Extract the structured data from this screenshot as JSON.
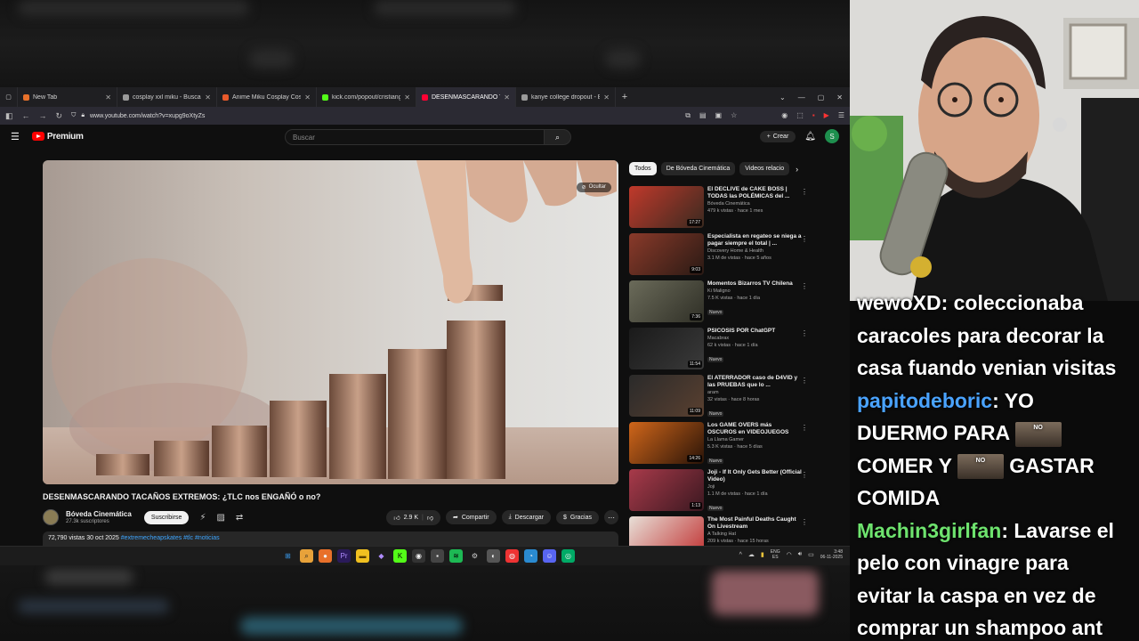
{
  "browser": {
    "tabs": [
      {
        "label": "New Tab",
        "favicon_color": "#e8712b",
        "active": false
      },
      {
        "label": "cosplay xxl miku - Buscar con G",
        "favicon_color": "#9a9a9a",
        "active": false
      },
      {
        "label": "Anime Miku Cosplay Costume |",
        "favicon_color": "#e85a2b",
        "active": false
      },
      {
        "label": "kick.com/popout/cristianghost",
        "favicon_color": "#53fc18",
        "active": false
      },
      {
        "label": "DESENMASCARANDO TACAÑ",
        "favicon_color": "#ff0033",
        "active": true
      },
      {
        "label": "kanye college dropout - Buscar",
        "favicon_color": "#9a9a9a",
        "active": false
      }
    ],
    "url": "www.youtube.com/watch?v=xupg9oXtyZs"
  },
  "youtube": {
    "logo_text": "Premium",
    "search_placeholder": "Buscar",
    "create_label": "Crear",
    "user_initial": "S",
    "hide_label": "Ocultar",
    "video_title": "DESENMASCARANDO TACAÑOS EXTREMOS: ¿TLC nos ENGAÑÓ o no?",
    "channel_name": "Bóveda Cinemática",
    "subscribers": "27.3k suscriptores",
    "subscribe_label": "Suscribirse",
    "likes": "2.9 K",
    "share_label": "Compartir",
    "download_label": "Descargar",
    "thanks_label": "Gracias",
    "views_date": "72,790 vistas  30 oct 2025",
    "tags": "#extremecheapskates #tlc #noticias",
    "chips": [
      "Todos",
      "De Bóveda Cinemática",
      "Videos relacio"
    ],
    "recommendations": [
      {
        "title": "El DECLIVE de CAKE BOSS | TODAS las POLÉMICAS del ...",
        "channel": "Bóveda Cinemática",
        "meta": "479 k vistas · hace 1 mes",
        "duration": "17:27",
        "badge": "",
        "thumb": [
          "#c0392b",
          "#3a2a20"
        ]
      },
      {
        "title": "Especialista en regateo se niega a pagar siempre el total | ...",
        "channel": "Discovery Home & Health",
        "meta": "3.1 M de vistas · hace 5 años",
        "duration": "9:03",
        "badge": "",
        "thumb": [
          "#8a3a2a",
          "#2a1a14"
        ]
      },
      {
        "title": "Momentos Bizarros TV Chilena",
        "channel": "Ki Maligno",
        "meta": "7.5 K vistas · hace 1 día",
        "duration": "7:36",
        "badge": "Nuevo",
        "thumb": [
          "#6b6b5a",
          "#2f2f26"
        ]
      },
      {
        "title": "PSICOSIS POR ChatGPT",
        "channel": "Macabrax",
        "meta": "62 k vistas · hace 1 día",
        "duration": "11:54",
        "badge": "Nuevo",
        "thumb": [
          "#1a1a1a",
          "#3a3a3a"
        ]
      },
      {
        "title": "El ATERRADOR caso de D4VID y las PRUEBAS que lo ...",
        "channel": "aram",
        "meta": "32 vistas · hace 8 horas",
        "duration": "11:09",
        "badge": "Nuevo",
        "thumb": [
          "#2a2a2a",
          "#5a4030"
        ]
      },
      {
        "title": "Los GAME OVERS más OSCUROS en VIDEOJUEGOS",
        "channel": "La Llama Gamer",
        "meta": "5.3 K vistas · hace 5 días",
        "duration": "14:26",
        "badge": "Nuevo",
        "thumb": [
          "#d0661a",
          "#2a1408"
        ]
      },
      {
        "title": "Joji - If It Only Gets Better (Official Video)",
        "channel": "Joji",
        "meta": "1.1 M de vistas · hace 1 día",
        "duration": "1:13",
        "badge": "Nuevo",
        "thumb": [
          "#a83a4a",
          "#3a1820"
        ]
      },
      {
        "title": "The Most Painful Deaths Caught On Livestream",
        "channel": "A Talking Hat",
        "meta": "209 k vistas · hace 15 horas",
        "duration": "",
        "badge": "",
        "thumb": [
          "#e8e0d8",
          "#c03030"
        ]
      }
    ]
  },
  "taskbar": {
    "lang": "ENG\nES",
    "time": "3:48\n06-11-2025"
  },
  "chat": [
    {
      "user": "wewoXD",
      "color": "#ffffff",
      "parts": [
        {
          "text": "coleccionaba"
        }
      ]
    },
    {
      "user": "",
      "color": "",
      "parts": [
        {
          "text": "caracoles para decorar la"
        }
      ]
    },
    {
      "user": "",
      "color": "",
      "parts": [
        {
          "text": "casa fuando venian visitas"
        }
      ]
    },
    {
      "user": "papitodeboric",
      "color": "#4aa3ff",
      "parts": [
        {
          "text": "YO"
        }
      ]
    },
    {
      "user": "",
      "color": "",
      "parts": [
        {
          "text": "DUERMO PARA "
        },
        {
          "emote": "NO"
        }
      ]
    },
    {
      "user": "",
      "color": "",
      "parts": [
        {
          "text": "COMER Y "
        },
        {
          "emote": "NO"
        },
        {
          "text": " GASTAR"
        }
      ]
    },
    {
      "user": "",
      "color": "",
      "parts": [
        {
          "text": "COMIDA"
        }
      ]
    },
    {
      "user": "Machin3girlfan",
      "color": "#6ee36e",
      "parts": [
        {
          "text": "Lavarse el"
        }
      ]
    },
    {
      "user": "",
      "color": "",
      "parts": [
        {
          "text": "pelo con vinagre para"
        }
      ]
    },
    {
      "user": "",
      "color": "",
      "parts": [
        {
          "text": "evitar la caspa en vez de"
        }
      ]
    },
    {
      "user": "",
      "color": "",
      "parts": [
        {
          "text": "comprar un shampoo ant"
        }
      ]
    }
  ]
}
